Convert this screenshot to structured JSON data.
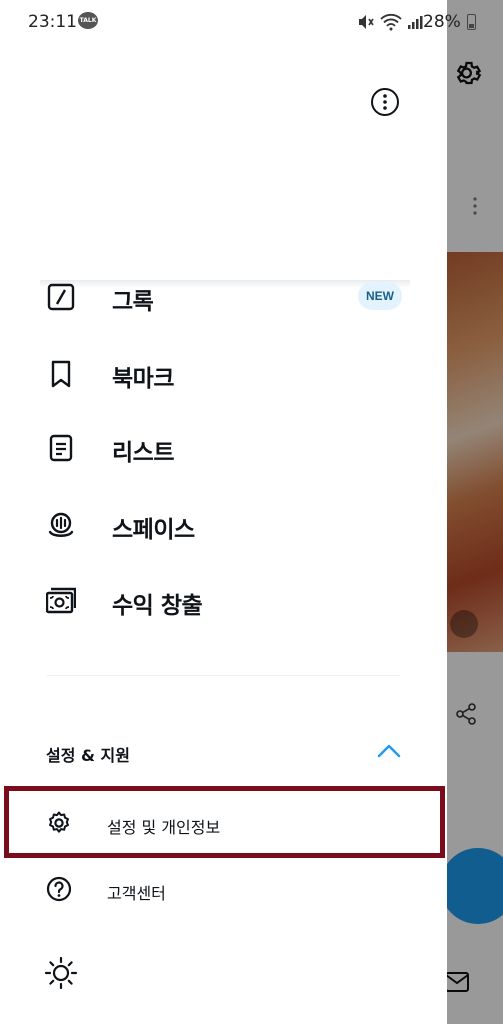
{
  "status_bar": {
    "time": "23:11",
    "talk_badge": "TALK",
    "battery": "28%"
  },
  "drawer": {
    "menu_items": [
      {
        "label": "그록",
        "icon": "grok-icon",
        "badge": "NEW"
      },
      {
        "label": "북마크",
        "icon": "bookmark-icon"
      },
      {
        "label": "리스트",
        "icon": "list-icon"
      },
      {
        "label": "스페이스",
        "icon": "spaces-icon"
      },
      {
        "label": "수익 창출",
        "icon": "monetization-icon"
      }
    ],
    "section": {
      "title": "설정 & 지원",
      "items": [
        {
          "label": "설정 및 개인정보",
          "icon": "gear-icon"
        },
        {
          "label": "고객센터",
          "icon": "help-icon"
        }
      ]
    }
  },
  "colors": {
    "accent": "#1d9bf0",
    "highlight_border": "#7a0c1c",
    "badge_bg": "#e3f3fd"
  }
}
